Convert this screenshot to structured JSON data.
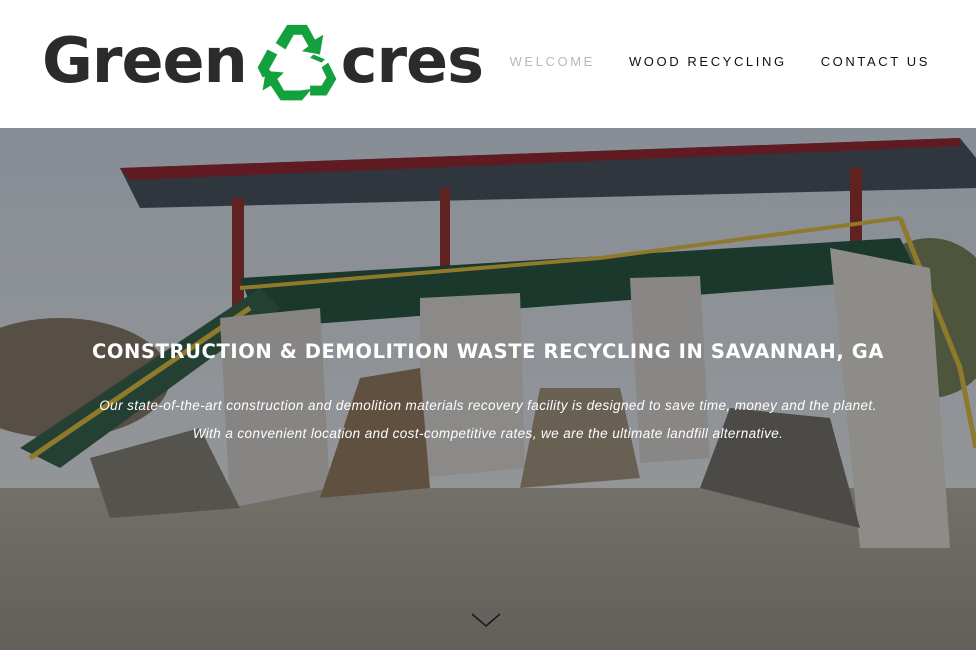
{
  "header": {
    "logo": {
      "text_left": "Green",
      "text_right": "cres",
      "icon": "recycle-icon"
    },
    "nav": [
      {
        "label": "WELCOME",
        "active": true
      },
      {
        "label": "WOOD RECYCLING",
        "active": false
      },
      {
        "label": "CONTACT US",
        "active": false
      }
    ]
  },
  "hero": {
    "title": "CONSTRUCTION & DEMOLITION WASTE RECYCLING IN SAVANNAH, GA",
    "subtitle_line1": "Our state-of-the-art construction and demolition materials recovery facility is designed to save time, money and the planet.",
    "subtitle_line2": "With a convenient location and cost-competitive rates, we are the ultimate landfill alternative.",
    "scroll_icon": "chevron-down-icon"
  },
  "colors": {
    "logo_green": "#12a13c",
    "logo_gray": "#2b2b2b",
    "nav_active": "#b9b9b9",
    "nav_text": "#111111"
  }
}
